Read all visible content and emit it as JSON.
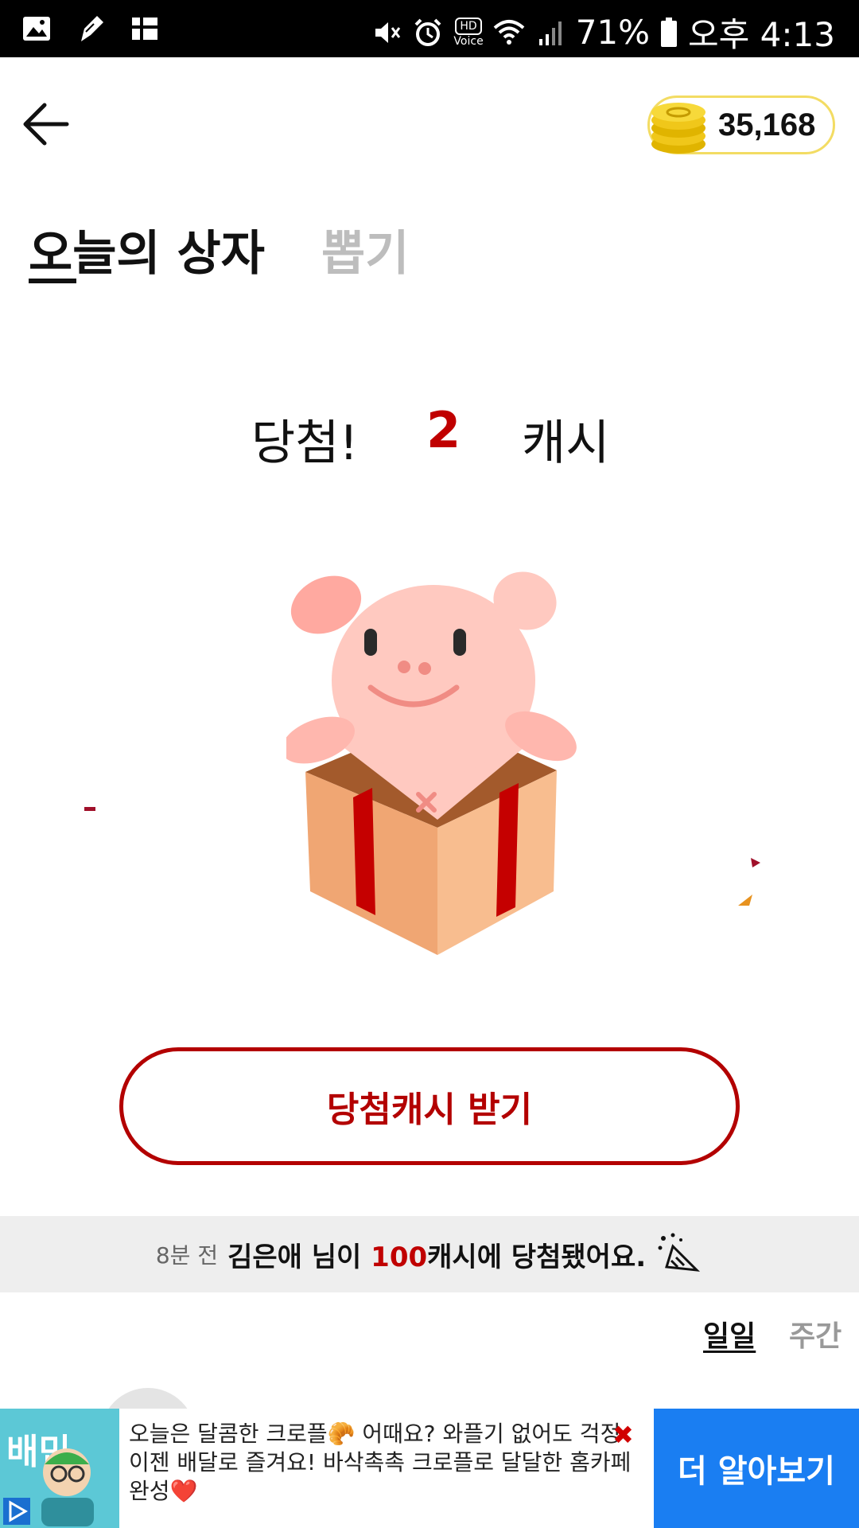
{
  "status_bar": {
    "battery": "71%",
    "time": "오후 4:13",
    "hd_label": "HD",
    "voice_label": "Voice",
    "left_icons": [
      "gallery-icon",
      "pen-icon",
      "app-grid-icon"
    ],
    "right_icons": [
      "mute-icon",
      "alarm-icon",
      "hd-voice-icon",
      "wifi-icon",
      "signal-icon",
      "battery-icon"
    ]
  },
  "header": {
    "coin_balance": "35,168",
    "coin_color": "#f3dc63"
  },
  "tabs": [
    {
      "label": "오늘의 상자",
      "active": true
    },
    {
      "label": "뽑기",
      "active": false
    }
  ],
  "result": {
    "won_label": "당첨!",
    "amount": "2",
    "unit": "캐시",
    "accent": "#c00000"
  },
  "claim_button": {
    "label": "당첨캐시 받기"
  },
  "ticker": {
    "time_ago": "8분 전",
    "prefix": "김은애 님이 ",
    "amount": "100",
    "suffix": "캐시에 당첨됐어요."
  },
  "period_tabs": {
    "daily": "일일",
    "weekly": "주간"
  },
  "ad": {
    "thumb_text": "배민",
    "line1": "오늘은 달콤한 크로플🥐 어때요? 와플기 없어도 걱정",
    "line2": "이젠 배달로 즐겨요! 바삭촉촉 크로플로 달달한 홈카페",
    "line3": "완성❤️",
    "close": "✖",
    "cta": "더 알아보기",
    "cta_color": "#1a7ef2"
  }
}
